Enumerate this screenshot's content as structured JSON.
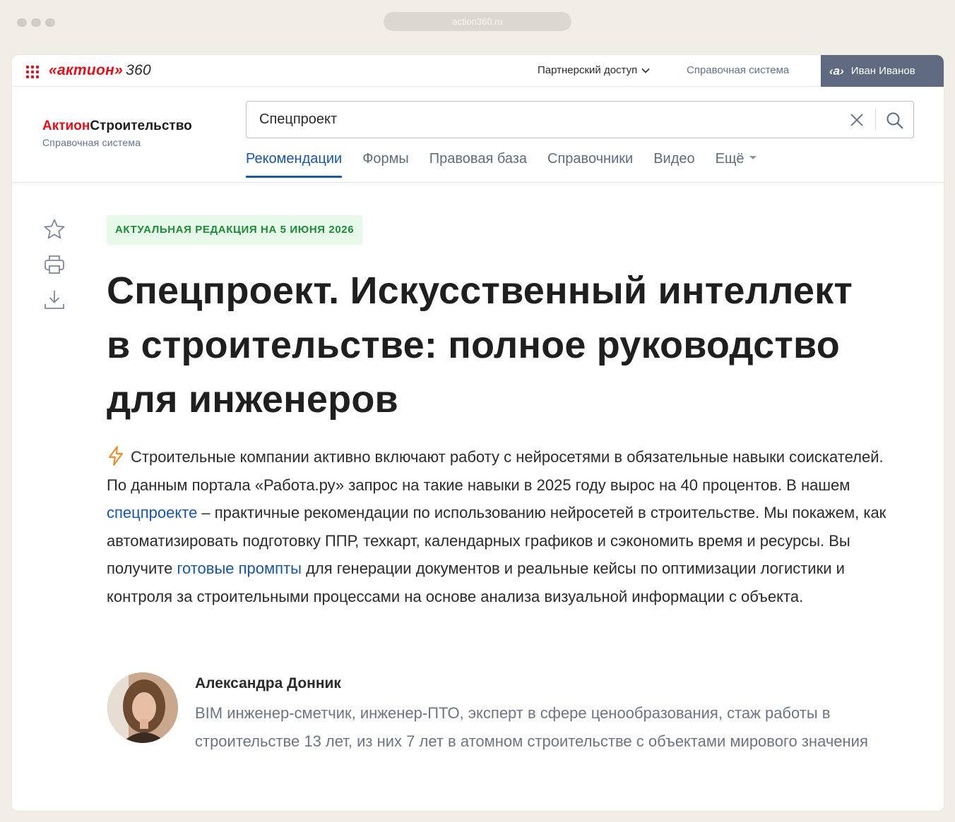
{
  "browser": {
    "url": "action360.ru"
  },
  "topbar": {
    "logo_text": "«актион»",
    "logo_number": "360",
    "partner_access": "Партнерский доступ",
    "reference_system": "Справочная система",
    "user_mark": "‹a›",
    "user_name": "Иван Иванов"
  },
  "header": {
    "brand_red": "Актион",
    "brand_black": "Строительство",
    "brand_sub": "Справочная система",
    "search_value": "Спецпроект",
    "tabs": [
      {
        "label": "Рекомендации",
        "active": true
      },
      {
        "label": "Формы",
        "active": false
      },
      {
        "label": "Правовая база",
        "active": false
      },
      {
        "label": "Справочники",
        "active": false
      },
      {
        "label": "Видео",
        "active": false
      },
      {
        "label": "Ещё",
        "active": false,
        "dropdown": true
      }
    ]
  },
  "tools": [
    {
      "icon": "star-icon"
    },
    {
      "icon": "print-icon"
    },
    {
      "icon": "download-icon"
    }
  ],
  "article": {
    "badge": "АКТУАЛЬНАЯ РЕДАКЦИЯ НА 5 ИЮНЯ 2026",
    "title": "Спецпроект. Искусственный интеллект в строительстве: полное руководство для инженеров",
    "lead_part1": "Строительные компании активно включают работу с нейросетями в обязательные навыки соискателей. По данным портала «Работа.ру» запрос на такие навыки в 2025 году вырос на 40 процентов. В нашем ",
    "lead_link1": "спецпроекте",
    "lead_part2": " – практичные рекомендации по использованию нейросетей в строительстве. Мы покажем, как автоматизировать подготовку ППР, техкарт, календарных графиков и сэкономить время и ресурсы. Вы получите ",
    "lead_link2": "готовые промпты",
    "lead_part3": " для генерации документов и реальные кейсы по оптимизации логистики и контроля за строительными процессами на основе анализа визуальной информации с объекта.",
    "lead_icon": "lightning-icon",
    "accent_color": "#f08a24",
    "link_color": "#1a56a6"
  },
  "author": {
    "name": "Александра Донник",
    "bio": "BIM инженер-сметчик, инженер-ПТО, эксперт в сфере ценообразования, стаж работы в строительстве 13 лет, из них 7 лет в атомном строительстве с объектами мирового значения"
  },
  "colors": {
    "brand_red": "#e3101a",
    "tab_active": "#1a56a6",
    "badge_bg": "#e7f9e9",
    "badge_text": "#1f8a3a",
    "user_button": "#5d6a80"
  }
}
